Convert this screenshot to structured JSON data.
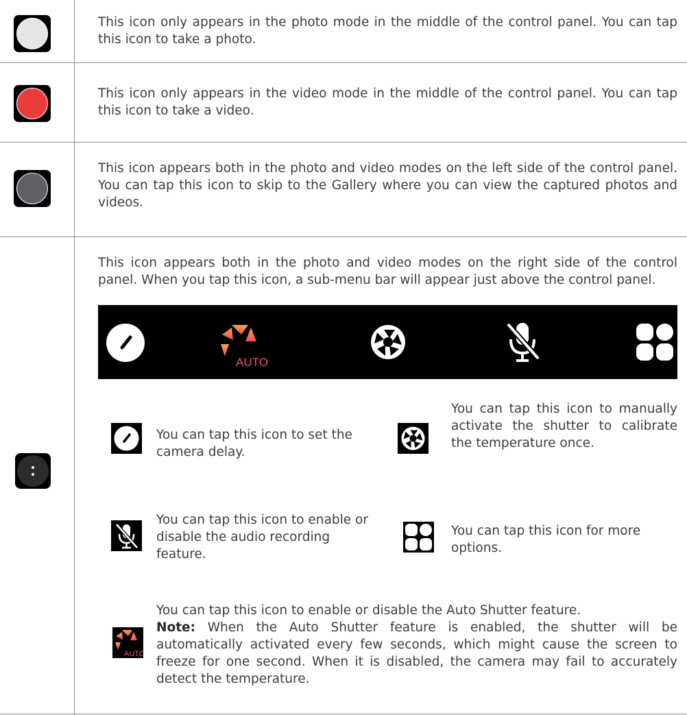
{
  "rows": [
    {
      "icon": "shutter-photo-icon",
      "color": "#e6e6e6",
      "text": "This icon only appears in the photo mode in the middle of the control panel. You can tap this icon to take a photo."
    },
    {
      "icon": "record-video-icon",
      "color": "#ea3c3c",
      "text": "This icon only appears in the video mode in the middle of the control panel. You can tap this icon to take a video."
    },
    {
      "icon": "gallery-icon",
      "color": "#5e6065",
      "text": "This icon appears both in the photo and video modes on the left side of the control panel. You can tap this icon to skip to the Gallery where you can view the captured photos and videos."
    },
    {
      "icon": "more-menu-icon",
      "color": "#2c2c2e",
      "text": "This icon appears both in the photo and video modes on the right side of the control panel. When you tap this icon, a sub-menu bar will appear just above the control panel."
    }
  ],
  "submenu": {
    "auto_label": "AUTO",
    "items": [
      {
        "icon": "timer-icon",
        "text": "You can tap this icon to set the camera delay."
      },
      {
        "icon": "shutter-calibrate-icon",
        "text": "You can tap this icon to manually activate the shutter to calibrate the temperature once."
      },
      {
        "icon": "mic-off-icon",
        "text": "You can tap this icon to enable or disable the audio recording feature."
      },
      {
        "icon": "more-options-icon",
        "text": "You can tap this icon for more options."
      }
    ],
    "auto_shutter": {
      "icon": "auto-shutter-icon",
      "line1": "You can tap this icon to enable or disable the Auto Shutter feature.",
      "note_label": "Note:",
      "note_text": " When the Auto Shutter feature is enabled, the shutter will be automatically activated every few seconds, which might cause the screen to freeze for one second. When it is disabled, the camera may fail to accurately detect the temperature."
    }
  }
}
